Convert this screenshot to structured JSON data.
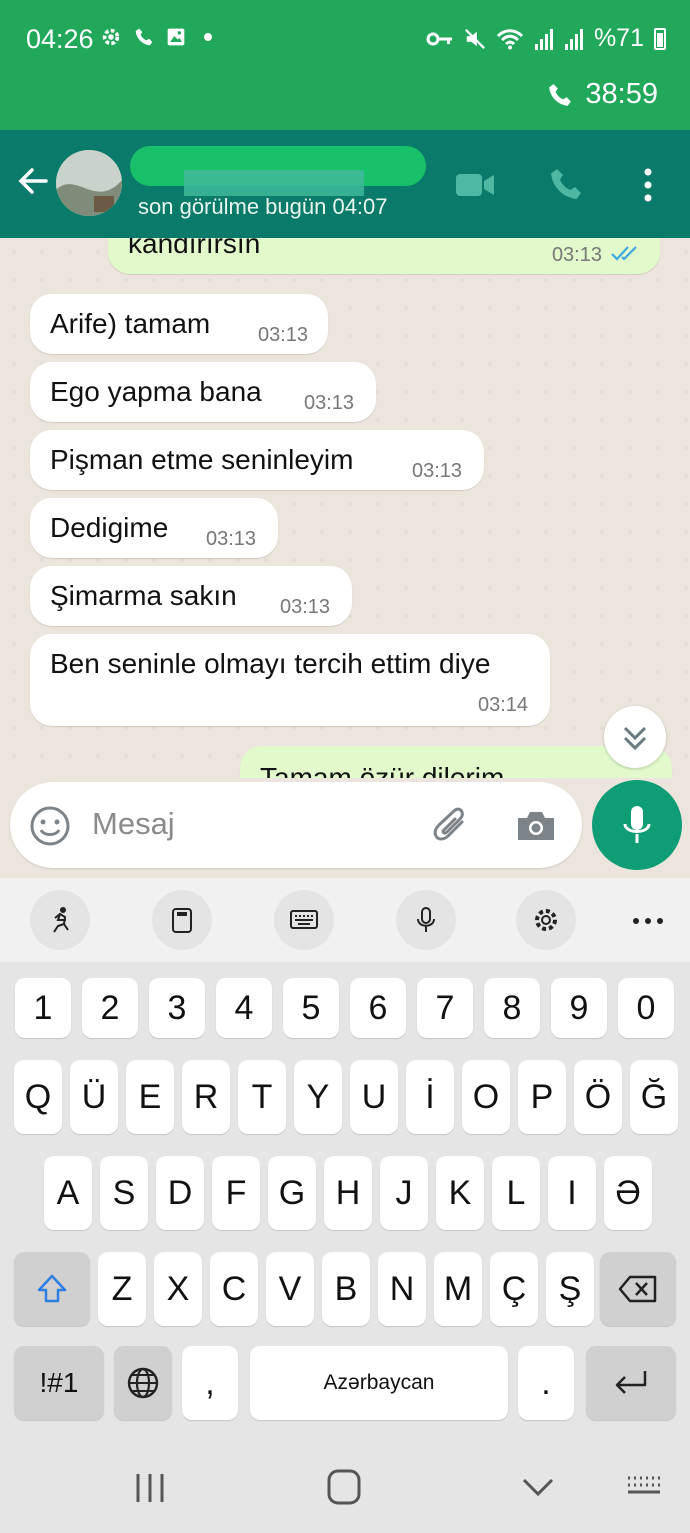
{
  "status_bar": {
    "time": "04:26",
    "battery": "%71"
  },
  "call_banner": {
    "timer": "38:59"
  },
  "header": {
    "contact_name": "",
    "last_seen": "son görülme bugün 04:07"
  },
  "messages": [
    {
      "direction": "out",
      "text": "kandırırsın",
      "time": "03:13",
      "status": "read"
    },
    {
      "direction": "in",
      "text": "Arife) tamam",
      "time": "03:13"
    },
    {
      "direction": "in",
      "text": "Ego yapma bana",
      "time": "03:13"
    },
    {
      "direction": "in",
      "text": "Pişman etme seninleyim",
      "time": "03:13"
    },
    {
      "direction": "in",
      "text": "Dedigime",
      "time": "03:13"
    },
    {
      "direction": "in",
      "text": "Şimarma sakın",
      "time": "03:13"
    },
    {
      "direction": "in",
      "text": "Ben seninle olmayı tercih ettim diye",
      "time": "03:14"
    },
    {
      "direction": "out",
      "text": "Tamam özür dilerim",
      "time": ""
    }
  ],
  "composer": {
    "placeholder": "Mesaj"
  },
  "keyboard": {
    "numbers": [
      "1",
      "2",
      "3",
      "4",
      "5",
      "6",
      "7",
      "8",
      "9",
      "0"
    ],
    "row1": [
      "Q",
      "Ü",
      "E",
      "R",
      "T",
      "Y",
      "U",
      "İ",
      "O",
      "P",
      "Ö",
      "Ğ"
    ],
    "row2": [
      "A",
      "S",
      "D",
      "F",
      "G",
      "H",
      "J",
      "K",
      "L",
      "I",
      "Ə"
    ],
    "row3": [
      "Z",
      "X",
      "C",
      "V",
      "B",
      "N",
      "M",
      "Ç",
      "Ş"
    ],
    "symbols_label": "!#1",
    "comma": ",",
    "space_label": "Azərbaycan",
    "period": "."
  },
  "colors": {
    "status_green": "#22a85a",
    "header_teal": "#0a7a6a",
    "outgoing_bubble": "#e1f9cb",
    "mic_button": "#0f9d76",
    "read_ticks": "#3fa8e0"
  }
}
